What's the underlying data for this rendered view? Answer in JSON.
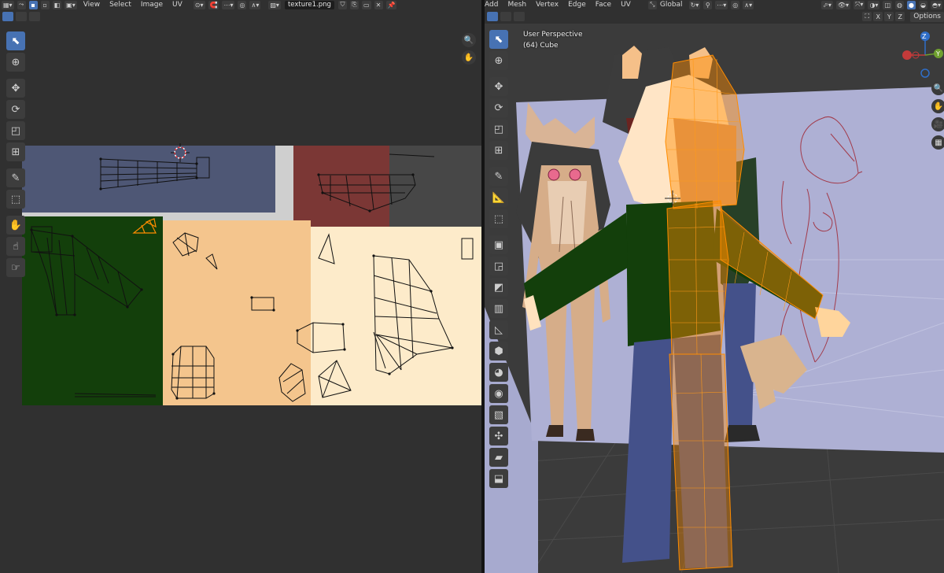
{
  "uv_editor": {
    "menus": [
      "View",
      "Select",
      "Image",
      "UV"
    ],
    "image_name": "texture1.png"
  },
  "viewport": {
    "menus": [
      "Add",
      "Mesh",
      "Vertex",
      "Edge",
      "Face",
      "UV"
    ],
    "transform_orientation": "Global",
    "axis_x": "X",
    "axis_y": "Y",
    "axis_z": "Z",
    "options_label": "Options",
    "view_name": "User Perspective",
    "object_info": "(64) Cube",
    "gizmo_z": "Z",
    "gizmo_y": "Y"
  },
  "colors": {
    "accent": "#4772b3",
    "tex_blue": "#4e5775",
    "tex_red": "#7b3735",
    "tex_dark": "#474747",
    "tex_green": "#133f0b",
    "tex_peach": "#f4c58d",
    "tex_cream": "#fdebca",
    "selection": "#ff8c00",
    "viewport_floor": "#3b3b3b",
    "viewport_wall": "#aeb0d4"
  }
}
